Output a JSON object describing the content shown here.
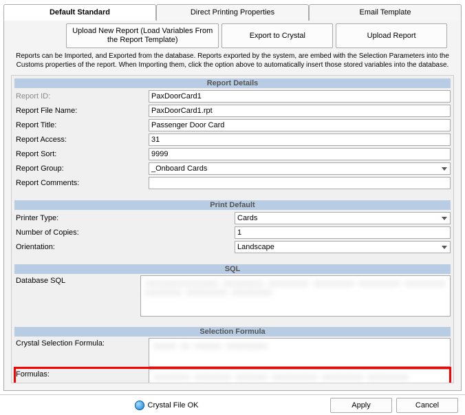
{
  "tabs": {
    "default_standard": "Default Standard",
    "direct_printing": "Direct Printing Properties",
    "email_template": "Email Template"
  },
  "actions": {
    "upload_new": "Upload New Report (Load Variables From the Report Template)",
    "export_crystal": "Export to Crystal",
    "upload_report": "Upload Report"
  },
  "help": "Reports can be Imported, and Exported from the database.  Reports exported by the system, are embed with the Selection Parameters into the Customs properties of the report.  When Importing them, click the option above to automatically insert those stored variables into the database.",
  "sections": {
    "report_details": "Report Details",
    "print_default": "Print Default",
    "sql": "SQL",
    "selection_formula": "Selection Formula"
  },
  "details": {
    "report_id_label": "Report ID:",
    "report_id": "PaxDoorCard1",
    "report_file_name_label": "Report File Name:",
    "report_file_name": "PaxDoorCard1.rpt",
    "report_title_label": "Report Title:",
    "report_title": "Passenger Door Card",
    "report_access_label": "Report Access:",
    "report_access": "31",
    "report_sort_label": "Report Sort:",
    "report_sort": "9999",
    "report_group_label": "Report Group:",
    "report_group": "_Onboard Cards",
    "report_comments_label": "Report Comments:",
    "report_comments": ""
  },
  "print_default": {
    "printer_type_label": "Printer Type:",
    "printer_type": "Cards",
    "copies_label": "Number of Copies:",
    "copies": "1",
    "orientation_label": "Orientation:",
    "orientation": "Landscape"
  },
  "sql": {
    "db_sql_label": "Database SQL"
  },
  "selection": {
    "crystal_label": "Crystal Selection Formula:",
    "formulas_label": "Formulas:"
  },
  "status": {
    "text": "Crystal File OK",
    "apply": "Apply",
    "cancel": "Cancel"
  }
}
